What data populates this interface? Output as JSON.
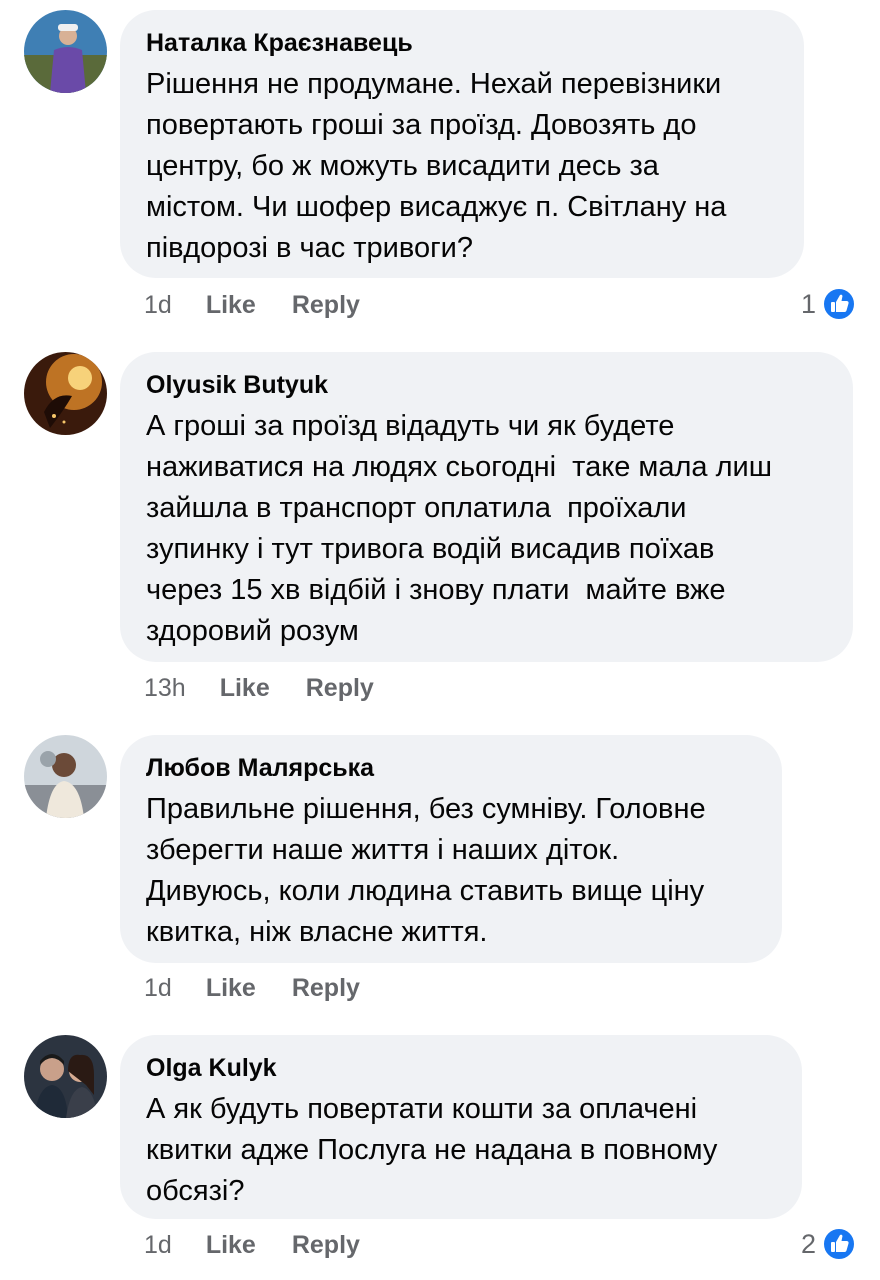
{
  "comments": [
    {
      "author": "Наталка Краєзнавець",
      "text": "Рішення не продумане. Нехай перевізники\nповертають гроші за проїзд. Довозять до\nцентру, бо ж можуть висадити десь за\nмістом. Чи шофер висаджує п. Світлану на\nпівдорозі в час тривоги?",
      "time": "1d",
      "like_label": "Like",
      "reply_label": "Reply",
      "reaction_count": "1"
    },
    {
      "author": "Olyusik  Butyuk",
      "text": "А гроші за проїзд відадуть чи як будете\nнаживатися на людях сьогодні  таке мала лиш\nзайшла в транспорт оплатила  проїхали\nзупинку і тут тривога водій висадив поїхав\nчерез 15 хв відбій і знову плати  майте вже\nздоровий розум",
      "time": "13h",
      "like_label": "Like",
      "reply_label": "Reply"
    },
    {
      "author": "Любов Малярська",
      "text": "Правильне рішення, без сумніву. Головне\nзберегти наше життя і наших діток.\nДивуюсь, коли людина ставить вище ціну\nквитка, ніж власне життя.",
      "time": "1d",
      "like_label": "Like",
      "reply_label": "Reply"
    },
    {
      "author": "Olga Kulyk",
      "text": "А як будуть повертати кошти за оплачені\nквитки адже Послуга не надана в повному\nобсязі?",
      "time": "1d",
      "like_label": "Like",
      "reply_label": "Reply",
      "reaction_count": "2"
    }
  ],
  "colors": {
    "bubble": "#f0f2f5",
    "meta_text": "#65676b",
    "like_blue": "#1877f2"
  },
  "icons": {
    "reaction": "thumbs-up-icon"
  }
}
